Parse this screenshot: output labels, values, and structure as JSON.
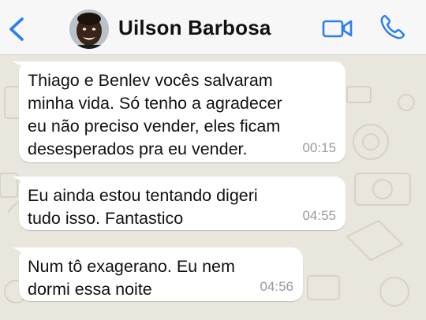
{
  "header": {
    "contact_name": "Uilson Barbosa",
    "back_icon": "chevron-left-icon",
    "video_icon": "video-camera-icon",
    "call_icon": "phone-icon"
  },
  "colors": {
    "accent": "#2a7ef0",
    "header_bg": "#f7f7f7",
    "chat_bg": "#e9e6de",
    "bubble_bg": "#ffffff",
    "time_text": "#9a9a9a"
  },
  "messages": [
    {
      "text": "Thiago e Benlev vocês salvaram\nminha vida. Só tenho a agradecer\neu não preciso vender, eles ficam\ndesesperados pra eu vender.",
      "time": "00:15"
    },
    {
      "text": "Eu ainda estou tentando digeri\ntudo isso. Fantastico",
      "time": "04:55"
    },
    {
      "text": "Num tô exagerano. Eu nem\ndormi essa noite",
      "time": "04:56"
    }
  ]
}
